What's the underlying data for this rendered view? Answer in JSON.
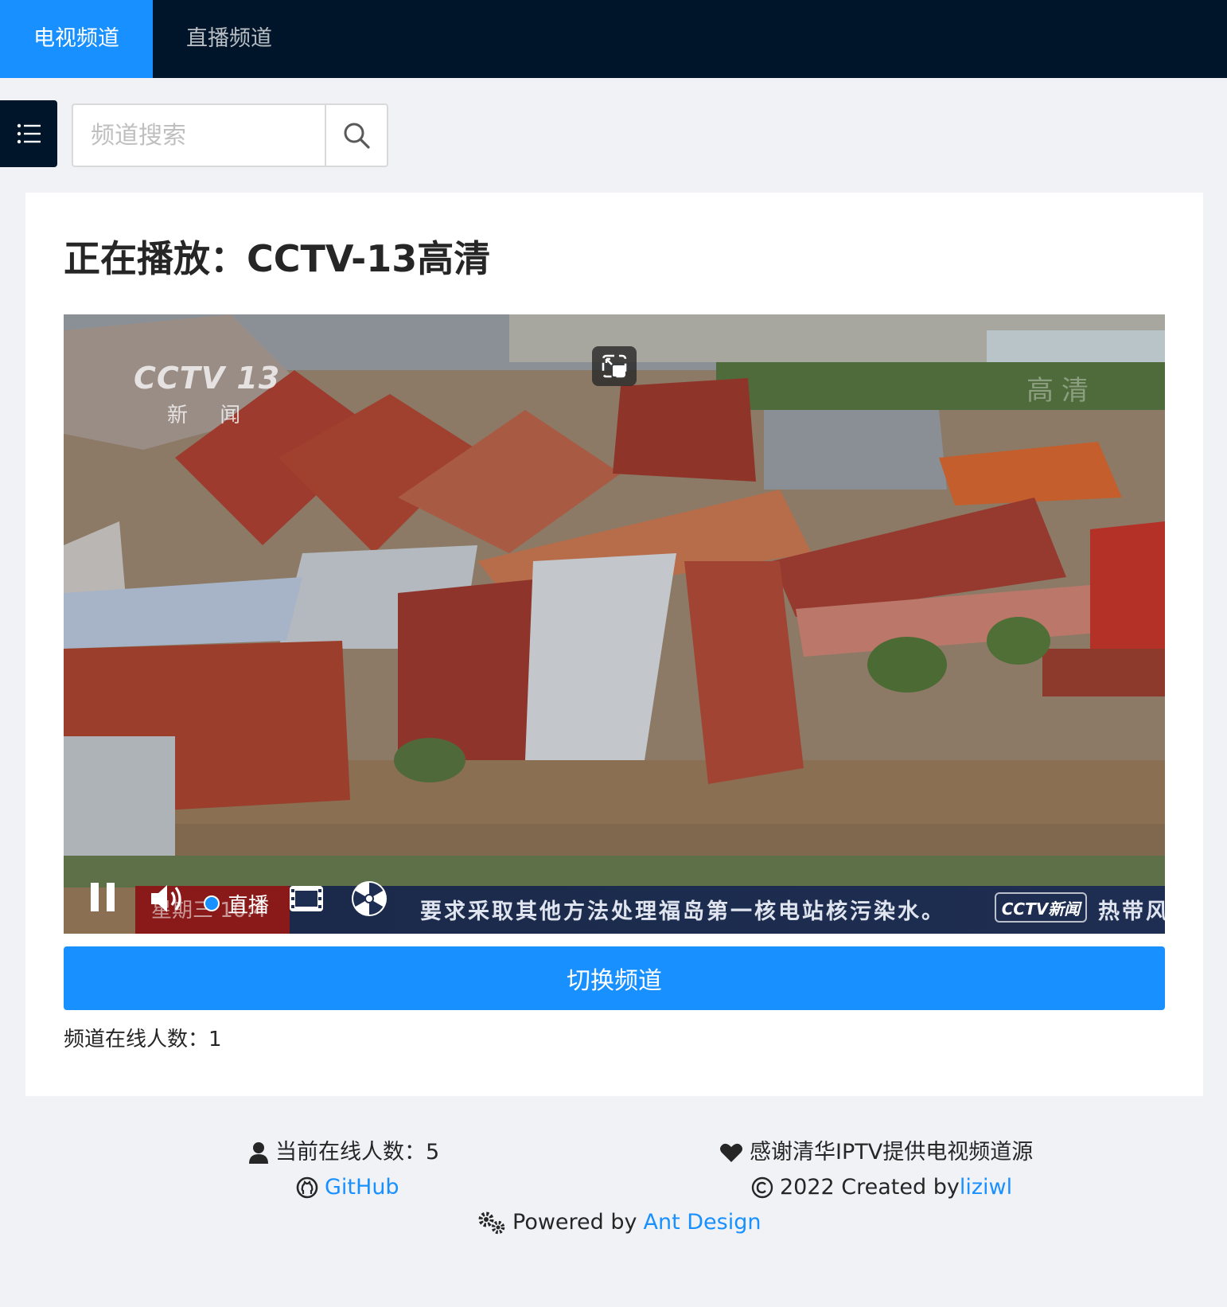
{
  "nav": {
    "items": [
      {
        "label": "电视频道",
        "active": true
      },
      {
        "label": "直播频道",
        "active": false
      }
    ]
  },
  "toolbar": {
    "menu_icon": "unordered-list-icon",
    "search": {
      "placeholder": "频道搜索",
      "value": ""
    },
    "search_icon": "search-icon"
  },
  "main": {
    "now_playing_label": "正在播放：",
    "channel_name": "CCTV-13高清",
    "video": {
      "watermark_logo": "CCTV 13",
      "watermark_sub": "新 闻",
      "hd_mark": "高清",
      "ticker_time": "星期三 10:4",
      "ticker_text": "要求采取其他方法处理福岛第一核电站核污染水。",
      "ticker_logo": "CCTV新闻",
      "ticker_text2": "热带风暴 “鲇",
      "live_label": "直播",
      "controls": [
        "pause-icon",
        "volume-icon",
        "fullscreen-icon",
        "radiation-icon",
        "pip-icon"
      ]
    },
    "switch_button": "切换频道",
    "channel_online_label": "频道在线人数：",
    "channel_online_count": "1"
  },
  "footer": {
    "online_label": "当前在线人数：",
    "online_count": "5",
    "github": "GitHub",
    "thanks": "感谢清华IPTV提供电视频道源",
    "created_prefix": "2022 Created by ",
    "created_by": "liziwl",
    "powered_prefix": "Powered by ",
    "powered_by": "Ant Design"
  },
  "colors": {
    "header_bg": "#001529",
    "primary": "#1890ff",
    "page_bg": "#f0f2f5"
  }
}
